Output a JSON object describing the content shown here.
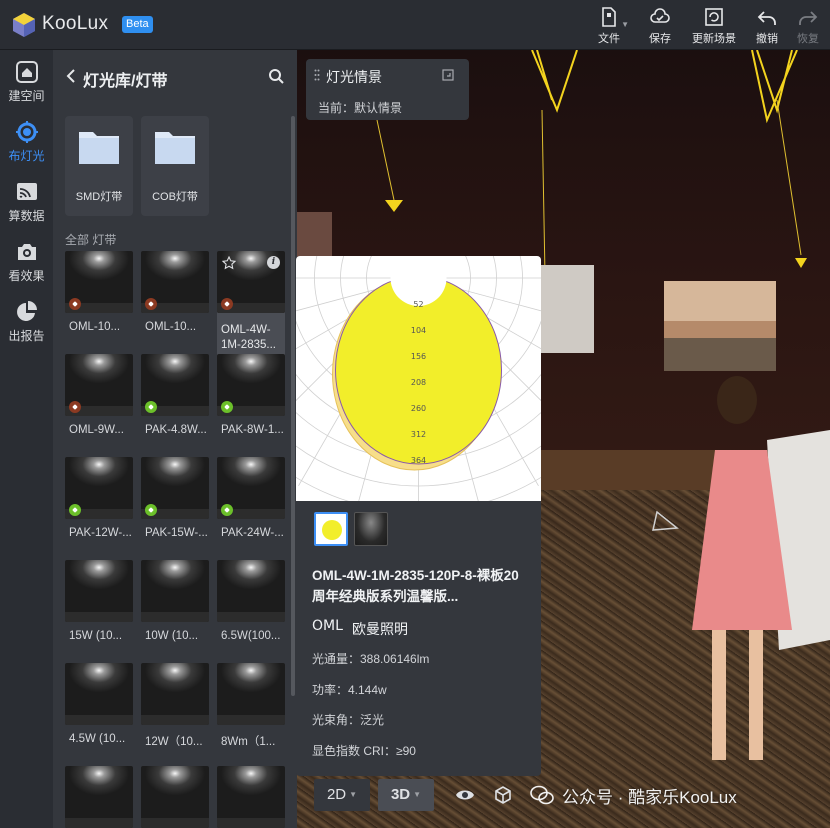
{
  "app": {
    "name": "KooLux",
    "badge": "Beta"
  },
  "toolbar": {
    "file": "文件",
    "save": "保存",
    "update_scene": "更新场景",
    "undo": "撤销",
    "redo": "恢复"
  },
  "rail": [
    {
      "label": "建空间",
      "icon": "home-icon"
    },
    {
      "label": "布灯光",
      "icon": "light-bulb-icon",
      "active": true
    },
    {
      "label": "算数据",
      "icon": "cast-icon"
    },
    {
      "label": "看效果",
      "icon": "camera-icon"
    },
    {
      "label": "出报告",
      "icon": "pie-chart-icon"
    }
  ],
  "library": {
    "title": "灯光库/灯带",
    "folders": [
      "SMD灯带",
      "COB灯带"
    ],
    "section": "全部 灯带",
    "items": [
      {
        "name": "OML-10...",
        "tag": "brown"
      },
      {
        "name": "OML-10...",
        "tag": "brown"
      },
      {
        "name": "OML-4W-1M-2835...",
        "tag": "brown",
        "hover": true
      },
      {
        "name": "OML-9W...",
        "tag": "brown"
      },
      {
        "name": "PAK-4.8W...",
        "tag": "green"
      },
      {
        "name": "PAK-8W-1...",
        "tag": "green"
      },
      {
        "name": "PAK-12W-...",
        "tag": "green"
      },
      {
        "name": "PAK-15W-...",
        "tag": "green"
      },
      {
        "name": "PAK-24W-...",
        "tag": "green"
      },
      {
        "name": "15W (10...",
        "tag": ""
      },
      {
        "name": "10W (10...",
        "tag": ""
      },
      {
        "name": "6.5W(100...",
        "tag": ""
      },
      {
        "name": "4.5W (10...",
        "tag": ""
      },
      {
        "name": "12W（10...",
        "tag": ""
      },
      {
        "name": "8Wm（1...",
        "tag": ""
      },
      {
        "name": "",
        "tag": ""
      },
      {
        "name": "",
        "tag": ""
      },
      {
        "name": "",
        "tag": ""
      }
    ]
  },
  "scene": {
    "title": "灯光情景",
    "current_label": "当前：",
    "current_value": "默认情景"
  },
  "product": {
    "name": "OML-4W-1M-2835-120P-8-裸板20周年经典版系列温馨版...",
    "brand_logo": "OML",
    "brand_cn": "欧曼照明",
    "specs": {
      "flux": "光通量：388.06146lm",
      "power": "功率：4.144w",
      "beam": "光束角：泛光",
      "cri": "显色指数 CRI：≥90"
    },
    "polar_ticks": [
      "52",
      "104",
      "156",
      "208",
      "260",
      "312",
      "364"
    ]
  },
  "view": {
    "mode_2d": "2D",
    "mode_3d": "3D"
  },
  "watermark": "公众号 · 酷家乐KooLux",
  "colors": {
    "accent": "#3d8ff5",
    "beta": "#2f8ff0",
    "curve": "#f2ee2a"
  }
}
